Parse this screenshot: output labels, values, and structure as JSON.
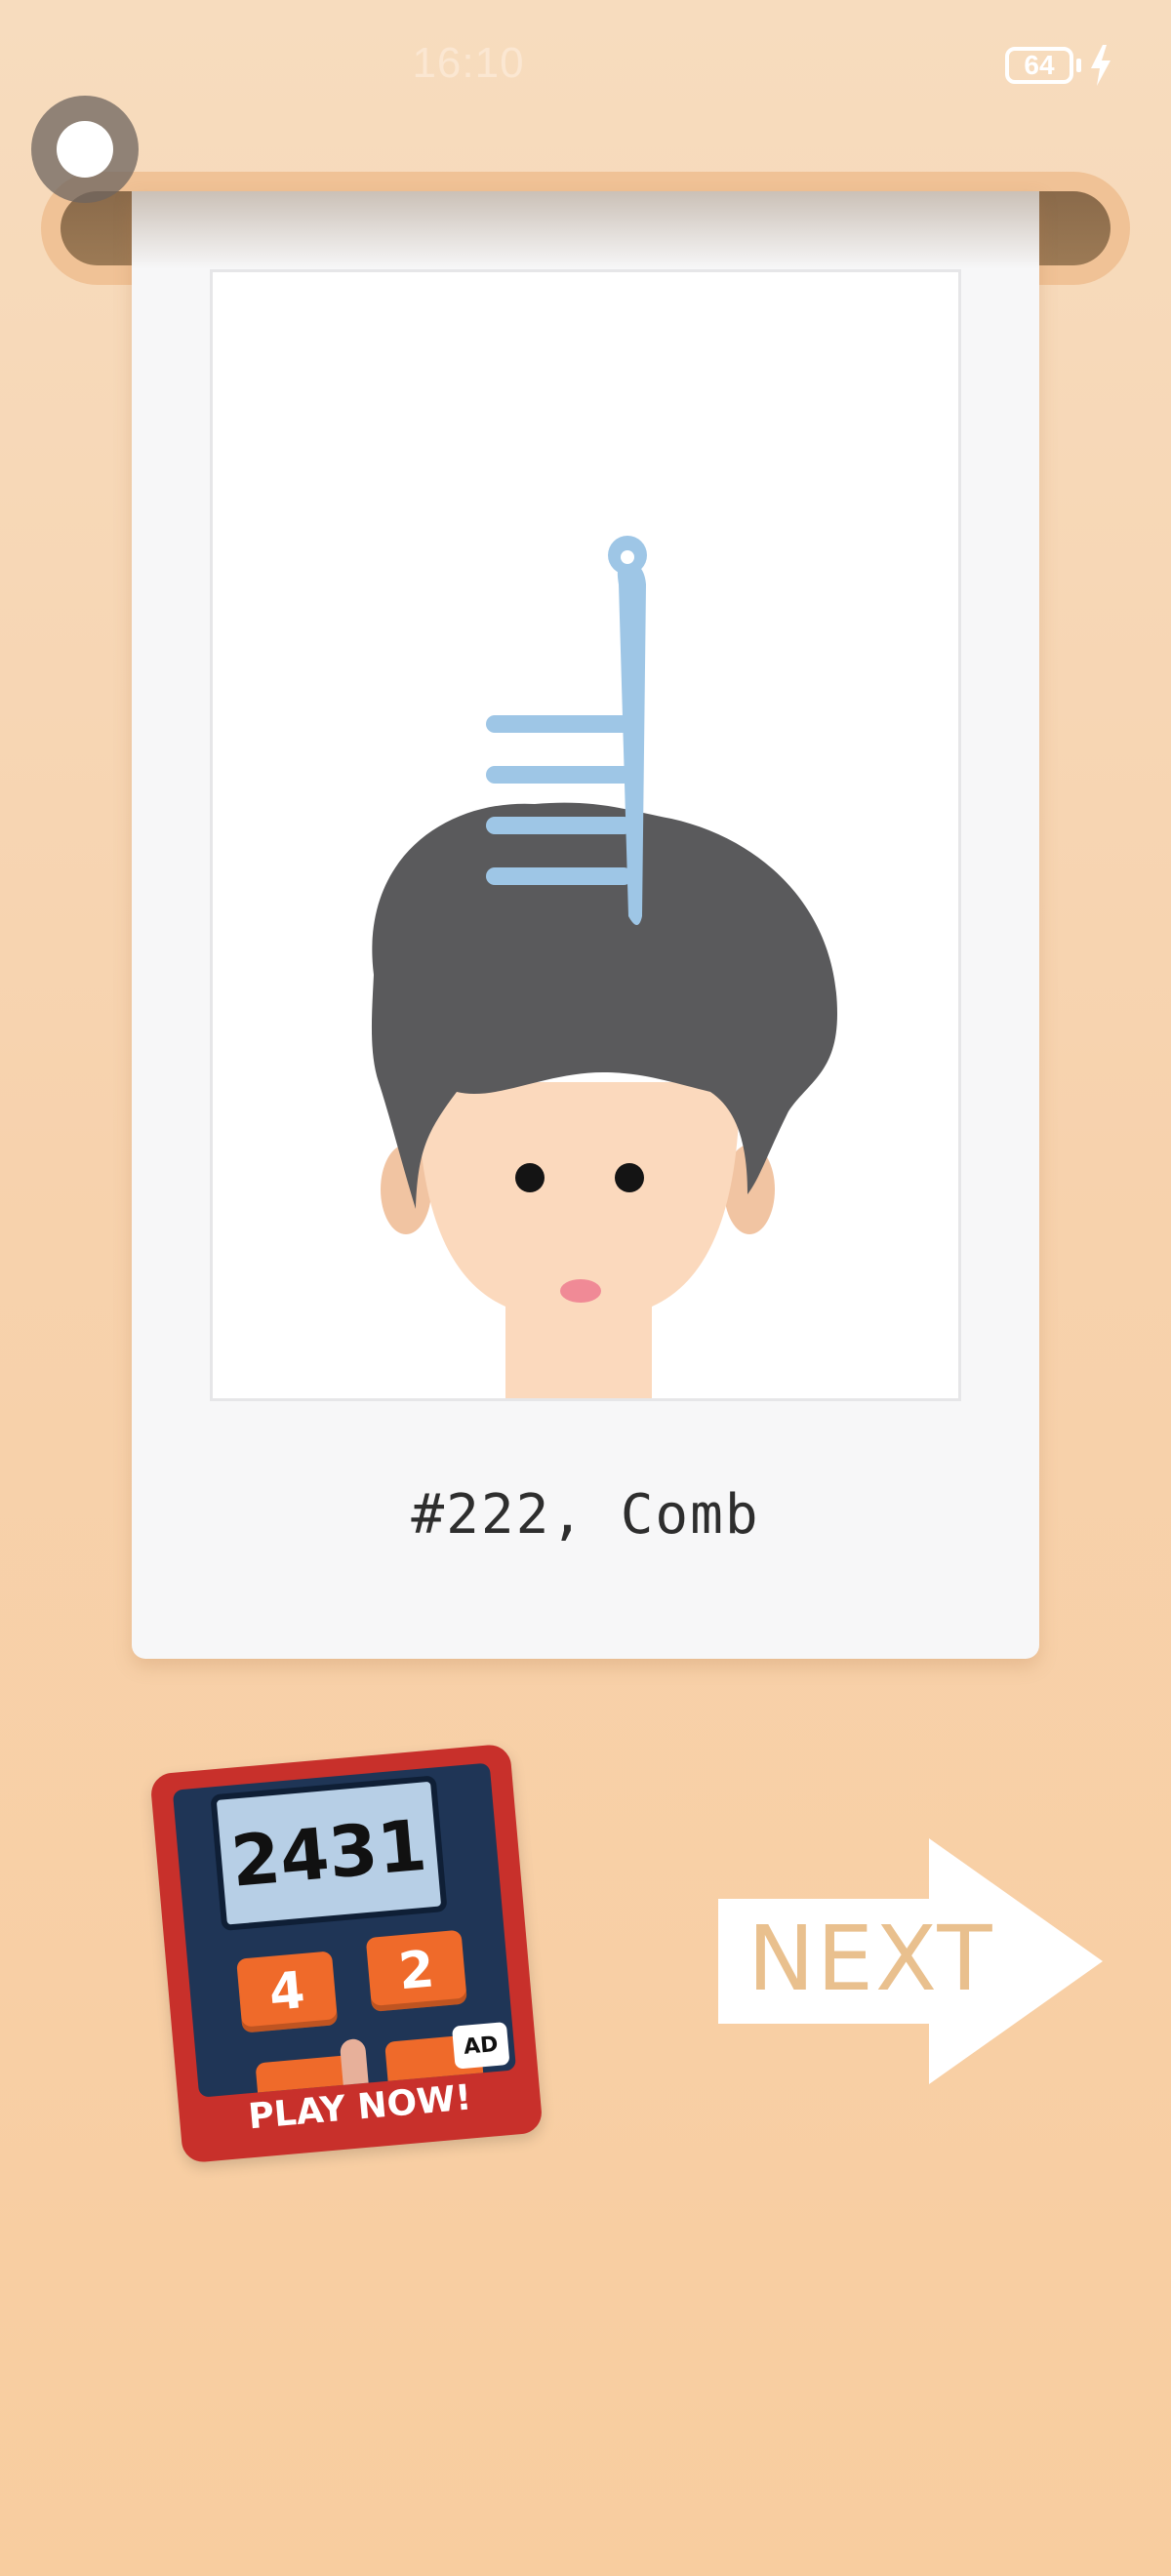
{
  "status_bar": {
    "time": "16:10",
    "battery": "64",
    "battery_charging": true
  },
  "level": {
    "caption": "#222, Comb"
  },
  "ad": {
    "number": "2431",
    "tiles": [
      "4",
      "2"
    ],
    "badge": "AD",
    "cta": "PLAY NOW!"
  },
  "next_button": {
    "label": "NEXT"
  },
  "colors": {
    "background": "#f7d2ad",
    "hair": "#5a5a5c",
    "skin": "#fbd9bd",
    "comb": "#9ec6e6",
    "ad_red": "#c8302b",
    "next_text": "#e9c08e"
  }
}
